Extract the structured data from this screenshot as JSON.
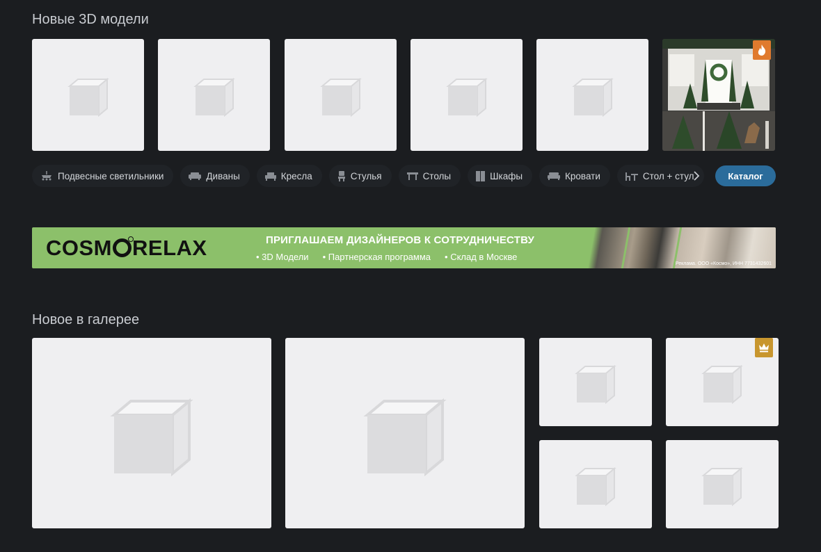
{
  "new_models": {
    "title": "Новые 3D модели",
    "items": [
      {
        "type": "placeholder"
      },
      {
        "type": "placeholder"
      },
      {
        "type": "placeholder"
      },
      {
        "type": "placeholder"
      },
      {
        "type": "placeholder"
      },
      {
        "type": "photo",
        "badge": "fire-icon",
        "badge_color": "#e07a2e"
      }
    ]
  },
  "categories": {
    "items": [
      {
        "label": "Подвесные светильники",
        "icon": "chandelier-icon"
      },
      {
        "label": "Диваны",
        "icon": "sofa-icon"
      },
      {
        "label": "Кресла",
        "icon": "armchair-icon"
      },
      {
        "label": "Стулья",
        "icon": "chair-icon"
      },
      {
        "label": "Столы",
        "icon": "table-icon"
      },
      {
        "label": "Шкафы",
        "icon": "wardrobe-icon"
      },
      {
        "label": "Кровати",
        "icon": "bed-icon"
      },
      {
        "label": "Стол + стул",
        "icon": "table-chair-icon"
      }
    ],
    "next_icon": "chevron-right-icon",
    "catalog_label": "Каталог"
  },
  "banner": {
    "logo_left": "COSM",
    "logo_right": "RELAX",
    "headline": "ПРИГЛАШАЕМ ДИЗАЙНЕРОВ К СОТРУДНИЧЕСТВУ",
    "points": [
      "3D Модели",
      "Партнерская программа",
      "Склад в Москве"
    ],
    "legal": "Реклама. ООО «Космо», ИНН 7731432601",
    "color": "#8cc06a"
  },
  "gallery": {
    "title": "Новое в галерее",
    "items": [
      {
        "type": "placeholder"
      },
      {
        "type": "placeholder"
      },
      {
        "type": "placeholder"
      },
      {
        "type": "placeholder",
        "badge": "crown-icon",
        "badge_color": "#c8962e"
      },
      {
        "type": "placeholder"
      },
      {
        "type": "placeholder"
      }
    ]
  },
  "colors": {
    "background": "#1b1d20",
    "accent": "#2b6c9b",
    "placeholder_bg": "#efeff1"
  }
}
